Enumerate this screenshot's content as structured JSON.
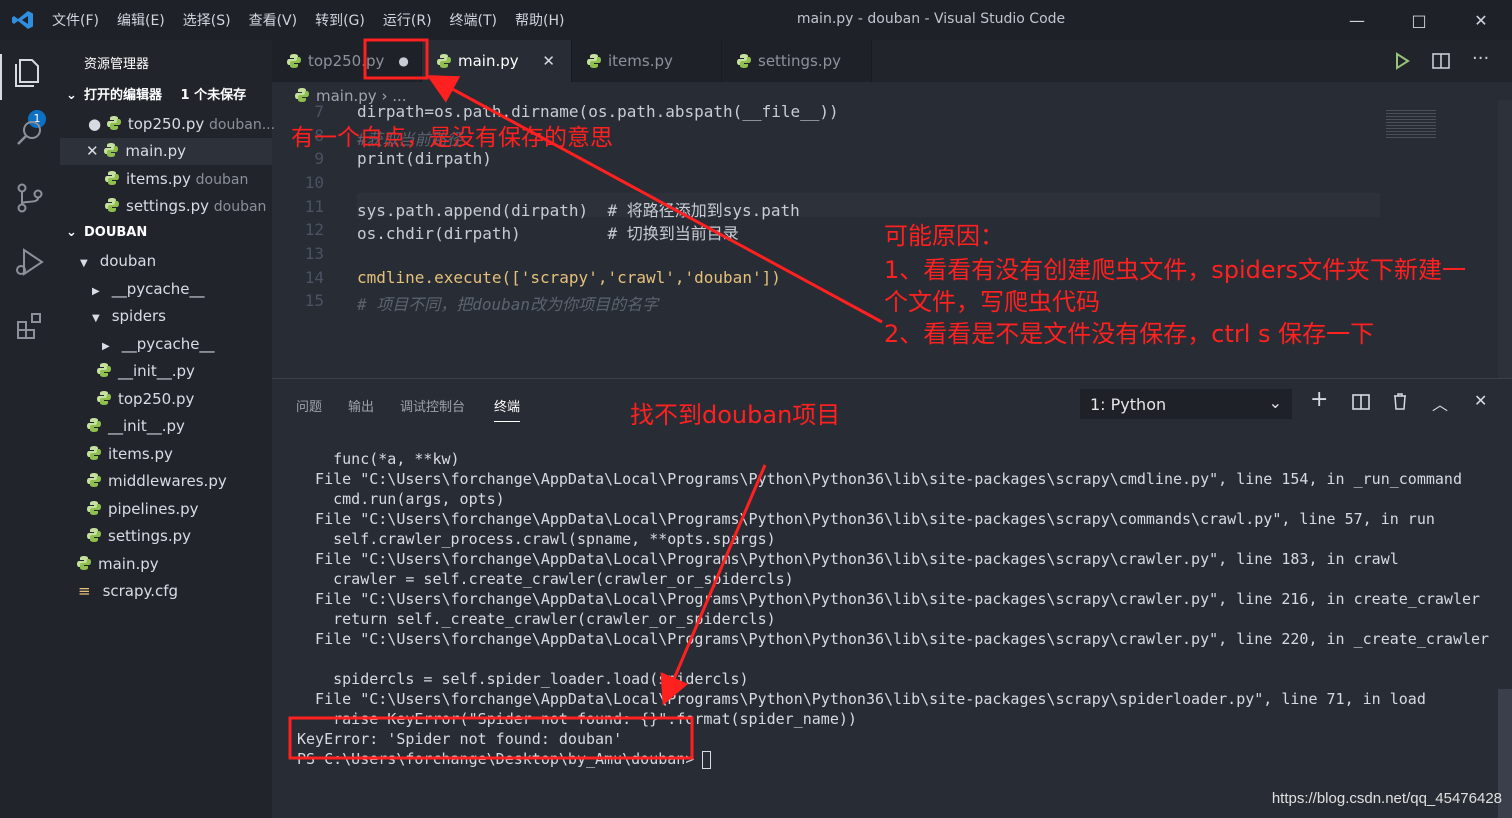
{
  "window": {
    "menu": [
      "文件(F)",
      "编辑(E)",
      "选择(S)",
      "查看(V)",
      "转到(G)",
      "运行(R)",
      "终端(T)",
      "帮助(H)"
    ],
    "title": "main.py - douban - Visual Studio Code"
  },
  "activity_bar": {
    "explorer_badge": "1"
  },
  "sidebar": {
    "title": "资源管理器",
    "open_editors_header": "打开的编辑器",
    "unsaved_count": "1 个未保存",
    "open_editors": [
      {
        "name": "top250.py",
        "dir": "douban...",
        "state": "dirty"
      },
      {
        "name": "main.py",
        "dir": "",
        "state": "close"
      },
      {
        "name": "items.py",
        "dir": "douban",
        "state": ""
      },
      {
        "name": "settings.py",
        "dir": "douban",
        "state": ""
      }
    ],
    "project_header": "DOUBAN",
    "tree": [
      "douban",
      "__pycache__",
      "spiders",
      "__pycache__",
      "__init__.py",
      "top250.py",
      "__init__.py",
      "items.py",
      "middlewares.py",
      "pipelines.py",
      "settings.py",
      "main.py",
      "scrapy.cfg"
    ]
  },
  "tabs": [
    {
      "label": "top250.py",
      "dirty": "●"
    },
    {
      "label": "main.py",
      "close": "✕"
    },
    {
      "label": "items.py"
    },
    {
      "label": "settings.py"
    }
  ],
  "breadcrumb": {
    "file": "main.py",
    "rest": "..."
  },
  "editor": {
    "line_numbers": [
      "7",
      "8",
      "9",
      "10",
      "11",
      "12",
      "13",
      "14",
      "15"
    ],
    "lines": [
      "dirpath=os.path.dirname(os.path.abspath(__file__))",
      "#获取当前路径",
      "print(dirpath)",
      "",
      "sys.path.append(dirpath)  # 将路径添加到sys.path",
      "os.chdir(dirpath)         # 切换到当前目录",
      "",
      "cmdline.execute(['scrapy','crawl','douban'])",
      "# 项目不同，把douban改为你项目的名字"
    ]
  },
  "panel": {
    "tabs": [
      "问题",
      "输出",
      "调试控制台",
      "终端"
    ],
    "terminal_select": "1: Python",
    "terminal_lines": [
      "    func(*a, **kw)",
      "  File \"C:\\Users\\forchange\\AppData\\Local\\Programs\\Python\\Python36\\lib\\site-packages\\scrapy\\cmdline.py\", line 154, in _run_command",
      "    cmd.run(args, opts)",
      "  File \"C:\\Users\\forchange\\AppData\\Local\\Programs\\Python\\Python36\\lib\\site-packages\\scrapy\\commands\\crawl.py\", line 57, in run",
      "    self.crawler_process.crawl(spname, **opts.spargs)",
      "  File \"C:\\Users\\forchange\\AppData\\Local\\Programs\\Python\\Python36\\lib\\site-packages\\scrapy\\crawler.py\", line 183, in crawl",
      "    crawler = self.create_crawler(crawler_or_spidercls)",
      "  File \"C:\\Users\\forchange\\AppData\\Local\\Programs\\Python\\Python36\\lib\\site-packages\\scrapy\\crawler.py\", line 216, in create_crawler",
      "    return self._create_crawler(crawler_or_spidercls)",
      "  File \"C:\\Users\\forchange\\AppData\\Local\\Programs\\Python\\Python36\\lib\\site-packages\\scrapy\\crawler.py\", line 220, in _create_crawler",
      "",
      "    spidercls = self.spider_loader.load(spidercls)",
      "  File \"C:\\Users\\forchange\\AppData\\Local\\Programs\\Python\\Python36\\lib\\site-packages\\scrapy\\spiderloader.py\", line 71, in load",
      "    raise KeyError(\"Spider not found: {}\".format(spider_name))",
      "KeyError: 'Spider not found: douban'",
      "PS C:\\Users\\forchange\\Desktop\\by_Amu\\douban> "
    ]
  },
  "annotations": {
    "dot_note": "有一个白点，是没有保存的意思",
    "cause_title": "可能原因：",
    "cause_1": "1、看看有没有创建爬虫文件，spiders文件夹下新建一",
    "cause_1b": "个文件，写爬虫代码",
    "cause_2": "2、看看是不是文件没有保存，ctrl s 保存一下",
    "not_found": "找不到douban项目"
  },
  "watermark": "https://blog.csdn.net/qq_45476428",
  "colors": {
    "annotation": "#ff2020",
    "accent": "#0e70c0",
    "background": "#282c34"
  }
}
